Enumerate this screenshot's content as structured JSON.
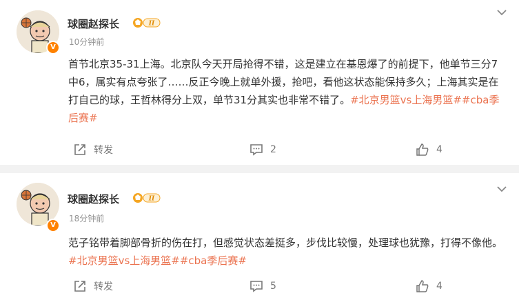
{
  "posts": [
    {
      "user": {
        "name": "球圈赵探长",
        "level": "II"
      },
      "time": "10分钟前",
      "text": "首节北京35-31上海。北京队今天开局抢得不错，这是建立在基恩爆了的前提下，他单节三分7中6，属实有点夸张了……反正今晚上就单外援，抢吧，看他这状态能保持多久；上海其实是在打自己的球，王哲林得分上双，单节31分其实也非常不错了。",
      "tags": "#北京男篮vs上海男篮##cba季后赛#",
      "actions": {
        "share": "转发",
        "comments": "2",
        "likes": "4"
      }
    },
    {
      "user": {
        "name": "球圈赵探长",
        "level": "II"
      },
      "time": "18分钟前",
      "text": "范子铭带着脚部骨折的伤在打，但感觉状态差挺多，步伐比较慢，处理球也犹豫，打得不像他。",
      "tags": "#北京男篮vs上海男篮##cba季后赛#",
      "actions": {
        "share": "转发",
        "comments": "5",
        "likes": "4"
      }
    }
  ],
  "colors": {
    "tag": "#eb7350",
    "vip": "#ff8200",
    "level_badge": "#f5a623"
  }
}
